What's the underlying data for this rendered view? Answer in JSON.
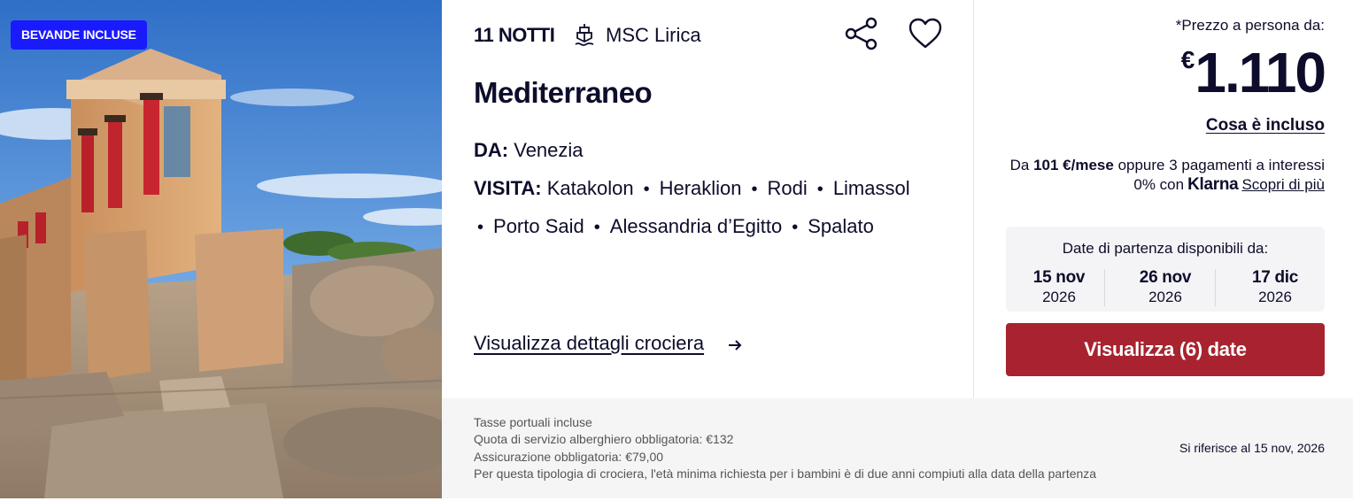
{
  "badge": {
    "label": "BEVANDE INCLUSE"
  },
  "cruise": {
    "nights": "11 NOTTI",
    "ship": "MSC Lirica",
    "title": "Mediterraneo",
    "from_label": "DA:",
    "from": "Venezia",
    "visit_label": "VISITA:",
    "ports": [
      "Katakolon",
      "Heraklion",
      "Rodi",
      "Limassol",
      "Porto Said",
      "Alessandria d’Egitto",
      "Spalato"
    ],
    "details_link": "Visualizza dettagli crociera"
  },
  "price": {
    "label": "*Prezzo a persona da:",
    "currency": "€",
    "amount": "1.110",
    "included_link": "Cosa è incluso",
    "klarna": {
      "prefix": "Da",
      "monthly": "101 €/mese",
      "text": "oppure 3 pagamenti a interessi",
      "zero": "0% con",
      "brand": "Klarna",
      "discover": "Scopri di più"
    }
  },
  "dates": {
    "title": "Date di partenza disponibili da:",
    "items": [
      {
        "day": "15 nov",
        "year": "2026"
      },
      {
        "day": "26 nov",
        "year": "2026"
      },
      {
        "day": "17 dic",
        "year": "2026"
      }
    ]
  },
  "cta": {
    "label": "Visualizza (6) date"
  },
  "footer": {
    "notes": [
      "Tasse portuali incluse",
      "Quota di servizio alberghiero obbligatoria: €132",
      "Assicurazione obbligatoria: €79,00",
      "Per questa tipologia di crociera, l'età minima richiesta per i bambini è di due anni compiuti alla data della partenza"
    ],
    "reference": "Si riferisce al 15 nov, 2026"
  },
  "icons": {
    "ship": "ship-icon",
    "share": "share-icon",
    "favorite": "heart-icon",
    "arrow": "arrow-right-icon"
  },
  "colors": {
    "badge": "#1a1aff",
    "cta": "#a8232f",
    "text": "#0d0d2b",
    "footer_bg": "#f5f5f5"
  }
}
